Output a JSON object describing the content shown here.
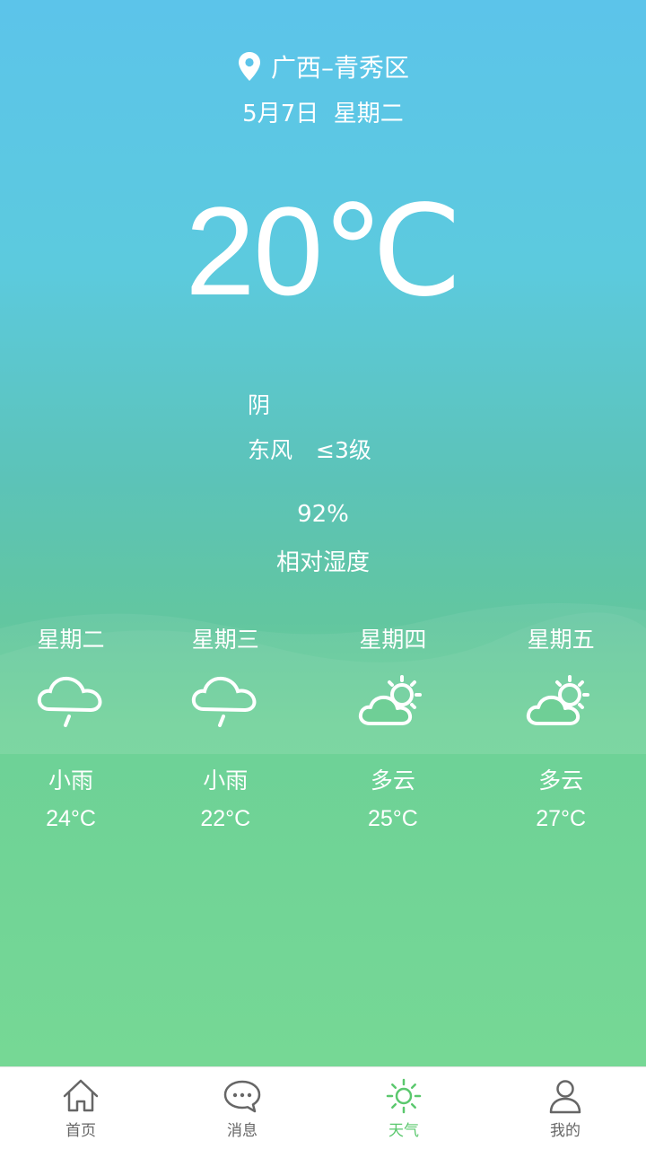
{
  "location": "广西–青秀区",
  "date": "5月7日",
  "weekday": "星期二",
  "temperature": "20℃",
  "condition": "阴",
  "wind_direction": "东风",
  "wind_level": "≤3级",
  "humidity_value": "92%",
  "humidity_label": "相对湿度",
  "forecast": [
    {
      "day": "星期二",
      "icon": "rain-cloud-icon",
      "condition": "小雨",
      "temp": "24°C"
    },
    {
      "day": "星期三",
      "icon": "rain-cloud-icon",
      "condition": "小雨",
      "temp": "22°C"
    },
    {
      "day": "星期四",
      "icon": "partly-cloudy-icon",
      "condition": "多云",
      "temp": "25°C"
    },
    {
      "day": "星期五",
      "icon": "partly-cloudy-icon",
      "condition": "多云",
      "temp": "27°C"
    }
  ],
  "tabs": [
    {
      "label": "首页",
      "icon": "home-icon"
    },
    {
      "label": "消息",
      "icon": "chat-bubble-icon"
    },
    {
      "label": "天气",
      "icon": "sun-icon",
      "active": true
    },
    {
      "label": "我的",
      "icon": "user-icon"
    }
  ],
  "colors": {
    "active_tab": "#5bc86e",
    "inactive_tab": "#666666"
  }
}
